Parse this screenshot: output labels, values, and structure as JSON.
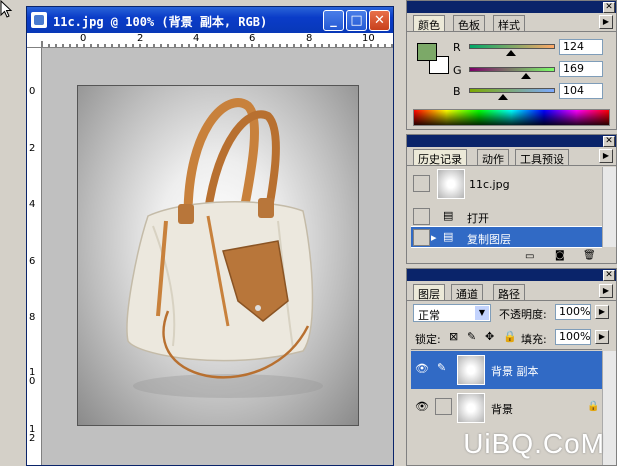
{
  "document": {
    "title": "11c.jpg @ 100% (背景 副本, RGB)",
    "ruler_top": [
      "0",
      "2",
      "4",
      "6",
      "8",
      "10"
    ],
    "ruler_left": [
      "0",
      "2",
      "4",
      "6",
      "8",
      "1 0",
      "1 2"
    ]
  },
  "color_panel": {
    "tabs": [
      "颜色",
      "色板",
      "样式"
    ],
    "channels": [
      {
        "label": "R",
        "value": "124"
      },
      {
        "label": "G",
        "value": "169"
      },
      {
        "label": "B",
        "value": "104"
      }
    ],
    "foreground": "#7ca968",
    "background": "#ffffff"
  },
  "history_panel": {
    "tabs": [
      "历史记录",
      "动作",
      "工具预设"
    ],
    "snapshot": "11c.jpg",
    "items": [
      "打开",
      "复制图层"
    ]
  },
  "layers_panel": {
    "tabs": [
      "图层",
      "通道",
      "路径"
    ],
    "blend_mode": "正常",
    "opacity_label": "不透明度:",
    "opacity_value": "100%",
    "lock_label": "锁定:",
    "fill_label": "填充:",
    "fill_value": "100%",
    "layers": [
      {
        "name": "背景 副本"
      },
      {
        "name": "背景"
      }
    ]
  },
  "watermark": "UiBQ.CoM"
}
